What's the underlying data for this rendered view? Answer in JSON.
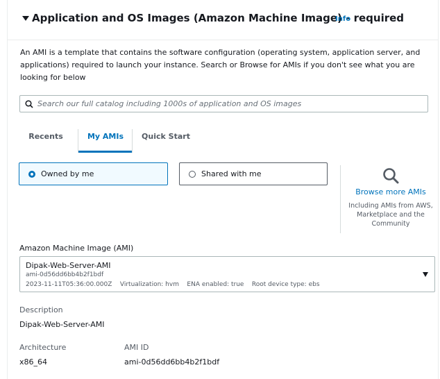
{
  "section": {
    "title": "Application and OS Images (Amazon Machine Image) - required",
    "info_link": "Info",
    "description": "An AMI is a template that contains the software configuration (operating system, application server, and applications) required to launch your instance. Search or Browse for AMIs if you don't see what you are looking for below"
  },
  "search": {
    "placeholder": "Search our full catalog including 1000s of application and OS images",
    "value": ""
  },
  "tabs": [
    {
      "label": "Recents",
      "active": false
    },
    {
      "label": "My AMIs",
      "active": true
    },
    {
      "label": "Quick Start",
      "active": false
    }
  ],
  "ownership": {
    "options": [
      {
        "label": "Owned by me",
        "selected": true
      },
      {
        "label": "Shared with me",
        "selected": false
      }
    ]
  },
  "browse": {
    "icon": "search-icon",
    "link_label": "Browse more AMIs",
    "note": "Including AMIs from AWS, Marketplace and the Community"
  },
  "ami_select": {
    "label": "Amazon Machine Image (AMI)",
    "name": "Dipak-Web-Server-AMI",
    "id": "ami-0d56dd6bb4b2f1bdf",
    "created": "2023-11-11T05:36:00.000Z",
    "virtualization": "Virtualization: hvm",
    "ena": "ENA enabled: true",
    "root_device": "Root device type: ebs"
  },
  "details": {
    "description_label": "Description",
    "description_value": "Dipak-Web-Server-AMI",
    "architecture_label": "Architecture",
    "architecture_value": "x86_64",
    "ami_id_label": "AMI ID",
    "ami_id_value": "ami-0d56dd6bb4b2f1bdf"
  },
  "colors": {
    "accent": "#0073bb",
    "text": "#16191f",
    "muted": "#545b64",
    "border": "#aab7b8"
  }
}
